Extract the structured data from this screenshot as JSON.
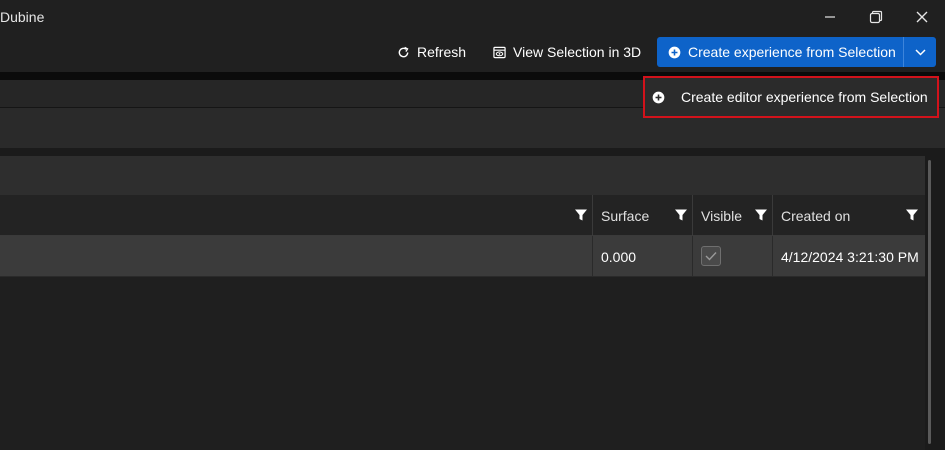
{
  "window": {
    "title": "Dubine"
  },
  "toolbar": {
    "refresh_label": "Refresh",
    "view_selection_label": "View Selection in 3D",
    "create_experience_label": "Create experience from Selection"
  },
  "dropdown": {
    "items": [
      {
        "label": "Create editor experience from Selection"
      }
    ]
  },
  "grid": {
    "columns": [
      {
        "label": ""
      },
      {
        "label": "Surface"
      },
      {
        "label": "Visible"
      },
      {
        "label": "Created on"
      }
    ],
    "rows": [
      {
        "name": "",
        "surface": "0.000",
        "visible": true,
        "created_on": "4/12/2024 3:21:30 PM"
      }
    ]
  },
  "colors": {
    "accent": "#0e63c9",
    "highlight_border": "#d2121b",
    "background": "#1f1f1f",
    "row_selected": "#3b3b3b"
  },
  "icons": {
    "refresh": "refresh-icon",
    "view3d": "view-3d-icon",
    "add": "plus-circle-icon",
    "chevron": "chevron-down-icon",
    "filter": "filter-icon",
    "check": "check-icon"
  }
}
